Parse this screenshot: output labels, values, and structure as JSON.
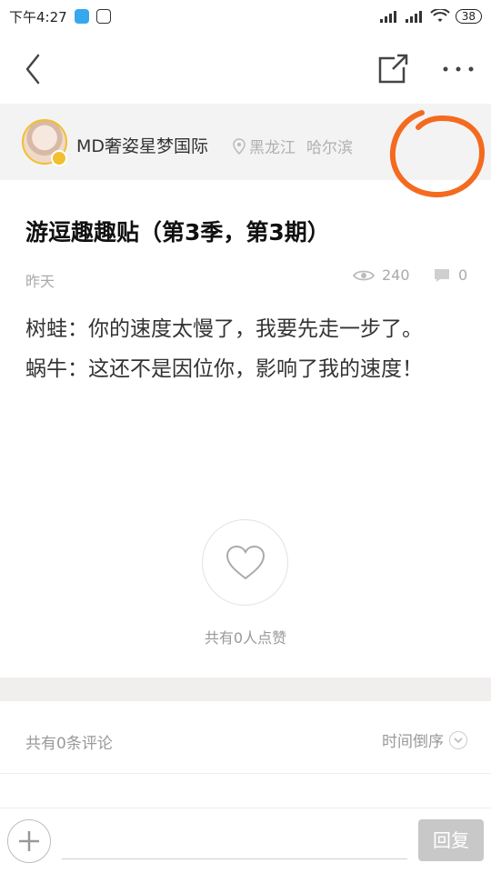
{
  "status_bar": {
    "time": "下午4:27",
    "battery": "38"
  },
  "author": {
    "name": "MD奢姿星梦国际",
    "province": "黑龙江",
    "city": "哈尔滨"
  },
  "post": {
    "title": "游逗趣趣贴（第3季，第3期）",
    "date": "昨天",
    "views": "240",
    "comments": "0",
    "content_lines": [
      "树蛙：你的速度太慢了，我要先走一步了。",
      "蜗牛：这还不是因位你，影响了我的速度！"
    ]
  },
  "likes": {
    "text": "共有0人点赞"
  },
  "comments_section": {
    "count_text": "共有0条评论",
    "sort_label": "时间倒序"
  },
  "bottom_bar": {
    "reply_label": "回复",
    "input_placeholder": ""
  },
  "colors": {
    "accent": "#f1bf2f",
    "annotation": "#f46a1f"
  },
  "icons": [
    "back-icon",
    "share-icon",
    "more-icon",
    "location-icon",
    "eye-icon",
    "comment-icon",
    "heart-icon",
    "plus-icon",
    "chevron-down-icon"
  ]
}
